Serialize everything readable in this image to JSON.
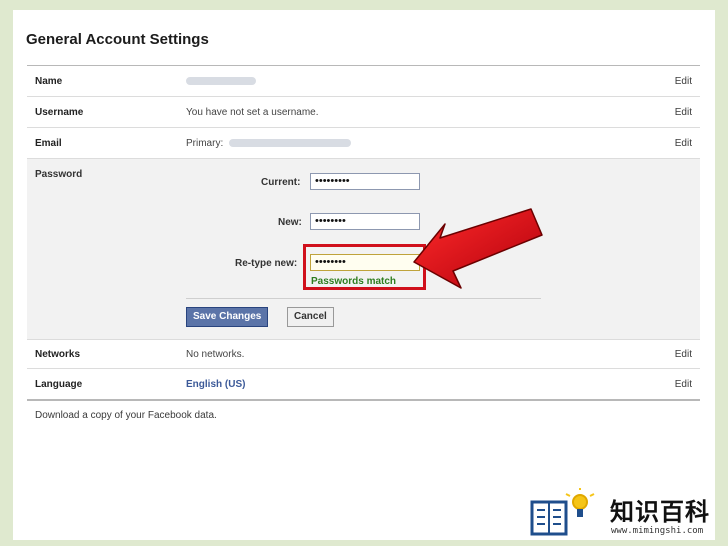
{
  "page": {
    "title": "General Account Settings",
    "download_text": "Download a copy of your Facebook data."
  },
  "rows": {
    "name": {
      "label": "Name",
      "edit": "Edit"
    },
    "username": {
      "label": "Username",
      "value": "You have not set a username.",
      "edit": "Edit"
    },
    "email": {
      "label": "Email",
      "prefix": "Primary:",
      "edit": "Edit"
    },
    "networks": {
      "label": "Networks",
      "value": "No networks.",
      "edit": "Edit"
    },
    "language": {
      "label": "Language",
      "value": "English (US)",
      "edit": "Edit"
    }
  },
  "password": {
    "label": "Password",
    "current_label": "Current:",
    "current_value": "•••••••••",
    "new_label": "New:",
    "new_value": "••••••••",
    "retype_label": "Re-type new:",
    "retype_value": "••••••••",
    "match_text": "Passwords match",
    "save_label": "Save Changes",
    "cancel_label": "Cancel"
  },
  "watermark": {
    "text": "知识百科",
    "url": "www.mimingshi.com"
  },
  "colors": {
    "highlight": "#d0101c",
    "button": "#5b74a8",
    "match": "#2e7d1f"
  }
}
